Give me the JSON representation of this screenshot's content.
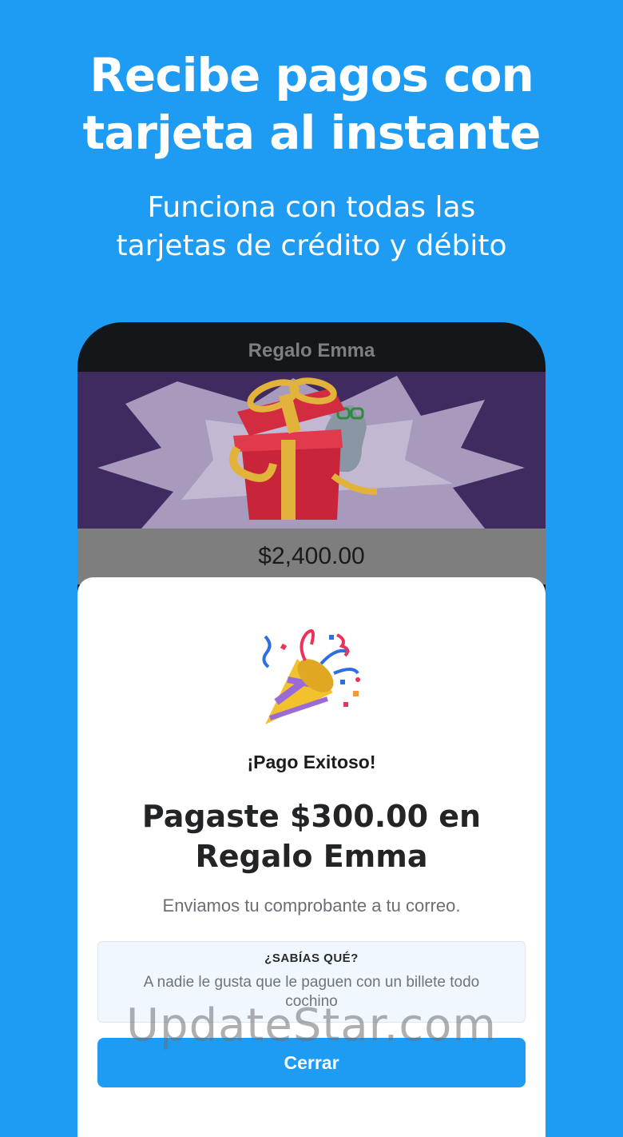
{
  "promo": {
    "headline_line1": "Recibe pagos con",
    "headline_line2": "tarjeta al instante",
    "subhead_line1": "Funciona con todas las",
    "subhead_line2": "tarjetas de crédito y débito"
  },
  "phone": {
    "title": "Regalo Emma",
    "amount": "$2,400.00",
    "hero_image": "gift-box-illustration"
  },
  "modal": {
    "icon": "party-popper-icon",
    "status": "¡Pago Exitoso!",
    "message_line1": "Pagaste $300.00 en",
    "message_line2": "Regalo Emma",
    "receipt_note": "Enviamos tu comprobante a tu correo.",
    "tip_title": "¿SABÍAS QUÉ?",
    "tip_text": "A nadie le gusta que le paguen con un billete todo cochino",
    "close_label": "Cerrar"
  },
  "watermark": "UpdateStar.com",
  "colors": {
    "background": "#1e9bf3",
    "accent": "#1e9bf3",
    "hero_bg": "#3f2b60"
  }
}
